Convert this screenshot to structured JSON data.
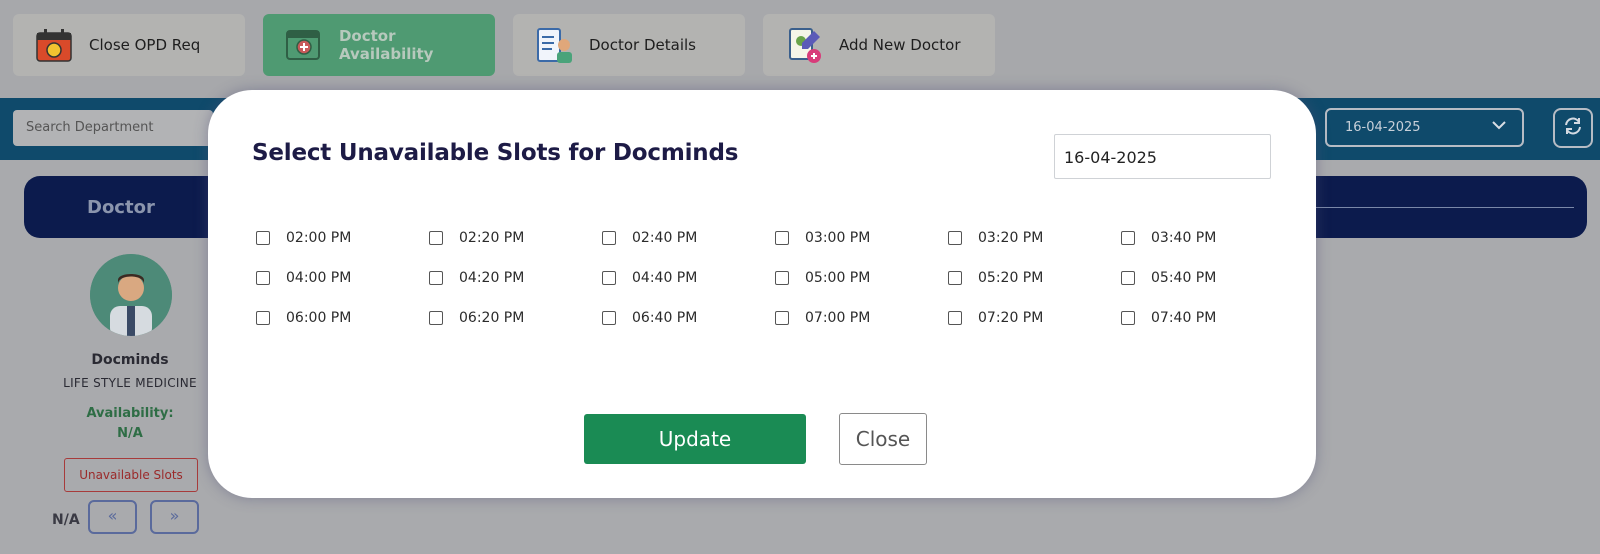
{
  "tabs": [
    {
      "label": "Close OPD Req",
      "icon": "calendar-alarm-icon",
      "active": false
    },
    {
      "label": "Doctor Availability",
      "icon": "calendar-stethoscope-icon",
      "active": true
    },
    {
      "label": "Doctor Details",
      "icon": "clipboard-doctor-icon",
      "active": false
    },
    {
      "label": "Add New Doctor",
      "icon": "clipboard-add-icon",
      "active": false
    }
  ],
  "filter": {
    "search_placeholder": "Search Department",
    "date": "16-04-2025"
  },
  "header": {
    "title": "Doctor"
  },
  "doctor": {
    "name": "Docminds",
    "department": "LIFE STYLE MEDICINE",
    "availability_label": "Availability:",
    "availability_value": "N/A",
    "unavailable_button": "Unavailable Slots",
    "nav_value": "N/A"
  },
  "modal": {
    "title": "Select Unavailable Slots for Docminds",
    "date": "16-04-2025",
    "slots": [
      "02:00 PM",
      "02:20 PM",
      "02:40 PM",
      "03:00 PM",
      "03:20 PM",
      "03:40 PM",
      "04:00 PM",
      "04:20 PM",
      "04:40 PM",
      "05:00 PM",
      "05:20 PM",
      "05:40 PM",
      "06:00 PM",
      "06:20 PM",
      "06:40 PM",
      "07:00 PM",
      "07:20 PM",
      "07:40 PM"
    ],
    "update_label": "Update",
    "close_label": "Close"
  },
  "colors": {
    "primary_dark": "#1d1b46",
    "update_green": "#1a8b54",
    "filter_bar": "#0f4a6b",
    "header_navy": "#0c1b4d"
  }
}
